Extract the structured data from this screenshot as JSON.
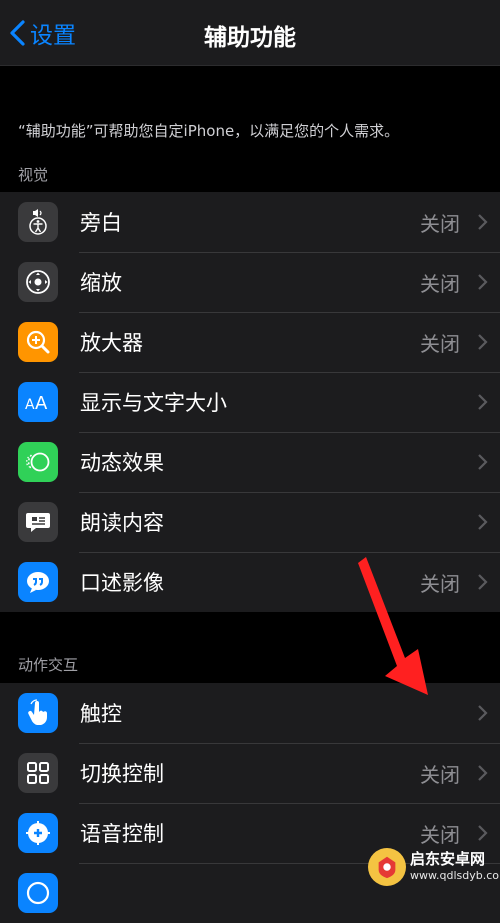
{
  "nav": {
    "back_label": "设置",
    "title": "辅助功能"
  },
  "description": "“辅助功能”可帮助您自定iPhone，以满足您的个人需求。",
  "sections": [
    {
      "header": "视觉",
      "items": [
        {
          "label": "旁白",
          "value": "关闭",
          "icon": "voiceover-icon",
          "color": "#3a3a3c"
        },
        {
          "label": "缩放",
          "value": "关闭",
          "icon": "zoom-icon",
          "color": "#3a3a3c"
        },
        {
          "label": "放大器",
          "value": "关闭",
          "icon": "magnifier-icon",
          "color": "#ff9500"
        },
        {
          "label": "显示与文字大小",
          "value": "",
          "icon": "text-size-icon",
          "color": "#0a84ff"
        },
        {
          "label": "动态效果",
          "value": "",
          "icon": "motion-icon",
          "color": "#30d158"
        },
        {
          "label": "朗读内容",
          "value": "",
          "icon": "spoken-content-icon",
          "color": "#3a3a3c"
        },
        {
          "label": "口述影像",
          "value": "关闭",
          "icon": "audio-description-icon",
          "color": "#0a84ff"
        }
      ]
    },
    {
      "header": "动作交互",
      "items": [
        {
          "label": "触控",
          "value": "",
          "icon": "touch-icon",
          "color": "#0a84ff"
        },
        {
          "label": "切换控制",
          "value": "关闭",
          "icon": "switch-control-icon",
          "color": "#3a3a3c"
        },
        {
          "label": "语音控制",
          "value": "关闭",
          "icon": "voice-control-icon",
          "color": "#0a84ff"
        },
        {
          "label": "",
          "value": "",
          "icon": "side-button-icon",
          "color": "#0a84ff"
        }
      ]
    }
  ],
  "watermark": {
    "title": "启东安卓网",
    "url": "www.qdlsdyb.com"
  }
}
